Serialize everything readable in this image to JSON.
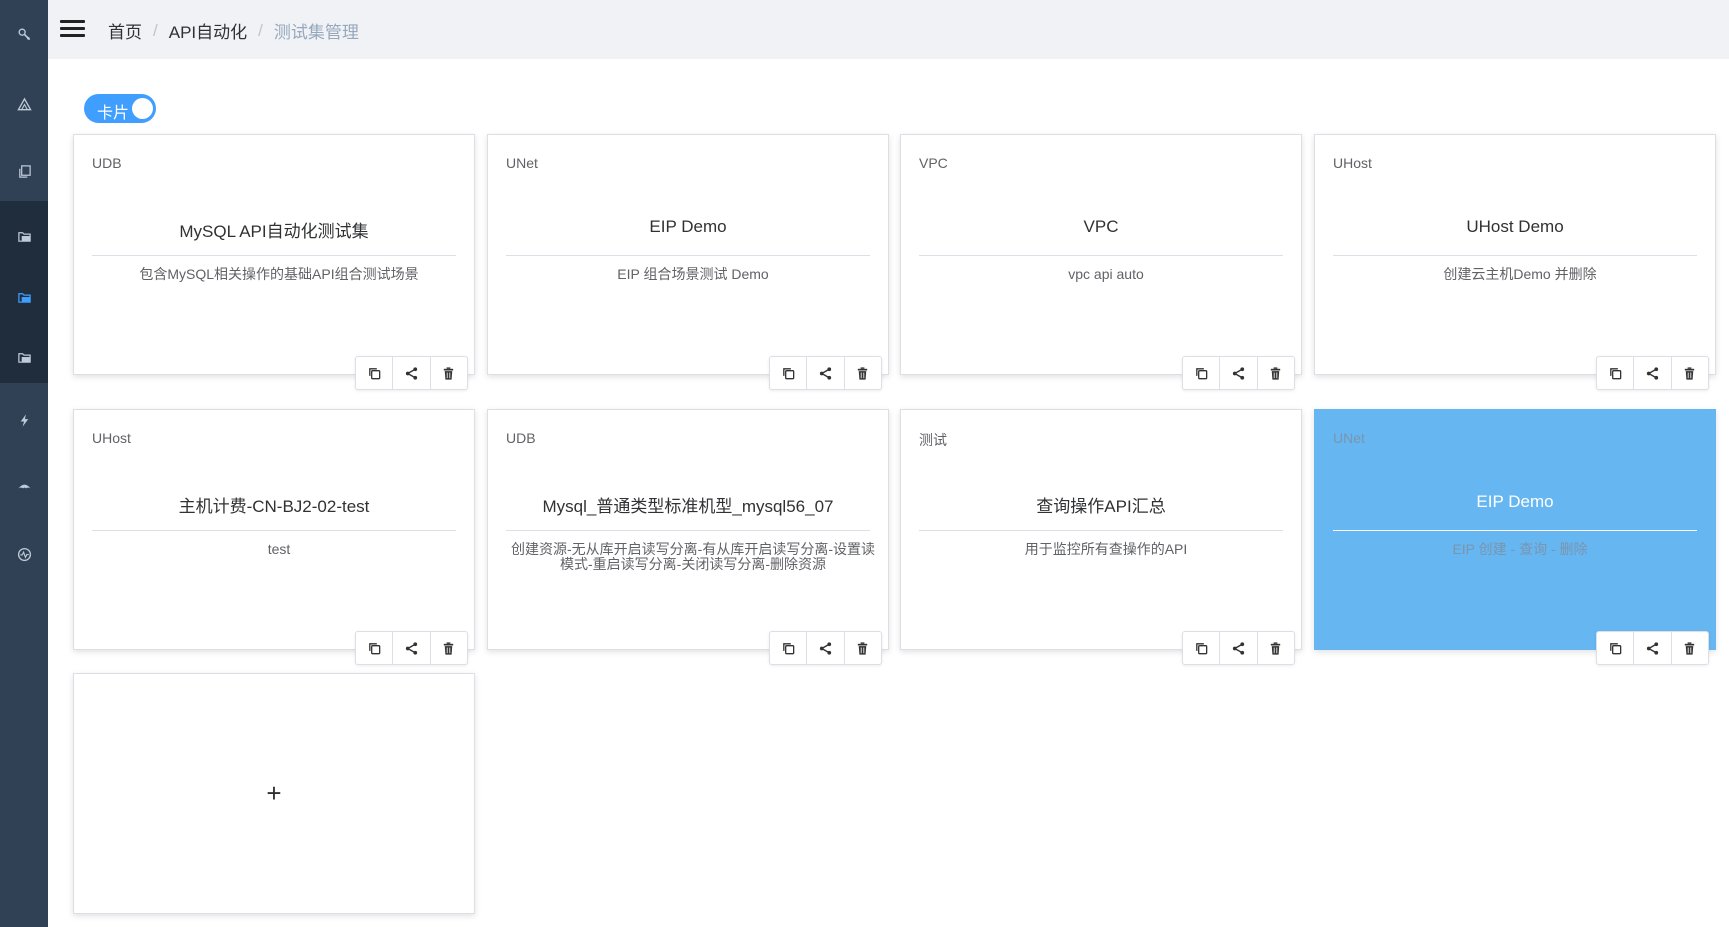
{
  "sidebar": {
    "items": [
      {
        "icon": "wrench-icon"
      },
      {
        "icon": "triangle-icon"
      },
      {
        "icon": "documents-icon"
      },
      {
        "icon": "folder-icon"
      },
      {
        "icon": "folder-icon"
      },
      {
        "icon": "folder-icon"
      },
      {
        "icon": "lightning-icon"
      },
      {
        "icon": "umbrella-icon"
      },
      {
        "icon": "pulse-icon"
      }
    ],
    "active_index": 4,
    "active_color": "#409eff"
  },
  "header": {
    "breadcrumb": [
      "首页",
      "API自动化",
      "测试集管理"
    ]
  },
  "view_toggle": {
    "label": "卡片",
    "on": true
  },
  "cards": [
    {
      "tag": "UDB",
      "title": "MySQL API自动化测试集",
      "desc": "包含MySQL相关操作的基础API组合测试场景"
    },
    {
      "tag": "UNet",
      "title": "EIP Demo",
      "desc": "EIP 组合场景测试 Demo"
    },
    {
      "tag": "VPC",
      "title": "VPC",
      "desc": "vpc api auto"
    },
    {
      "tag": "UHost",
      "title": "UHost Demo",
      "desc": "创建云主机Demo 并删除"
    },
    {
      "tag": "UHost",
      "title": "主机计费-CN-BJ2-02-test",
      "desc": "test"
    },
    {
      "tag": "UDB",
      "title": "Mysql_普通类型标准机型_mysql56_07",
      "desc": "创建资源-无从库开启读写分离-有从库开启读写分离-设置读模式-重启读写分离-关闭读写分离-删除资源"
    },
    {
      "tag": "测试",
      "title": "查询操作API汇总",
      "desc": "用于监控所有查操作的API"
    },
    {
      "tag": "UNet",
      "title": "EIP Demo",
      "desc": "EIP 创建 - 查询 - 删除",
      "active": true
    }
  ],
  "card_actions": [
    "copy-icon",
    "share-icon",
    "trash-icon"
  ],
  "add_card": {
    "symbol": "+"
  },
  "colors": {
    "sidebar_bg": "#304156",
    "submenu_bg": "#1f2d3d",
    "accent": "#409eff",
    "active_card": "#66b6f2"
  }
}
